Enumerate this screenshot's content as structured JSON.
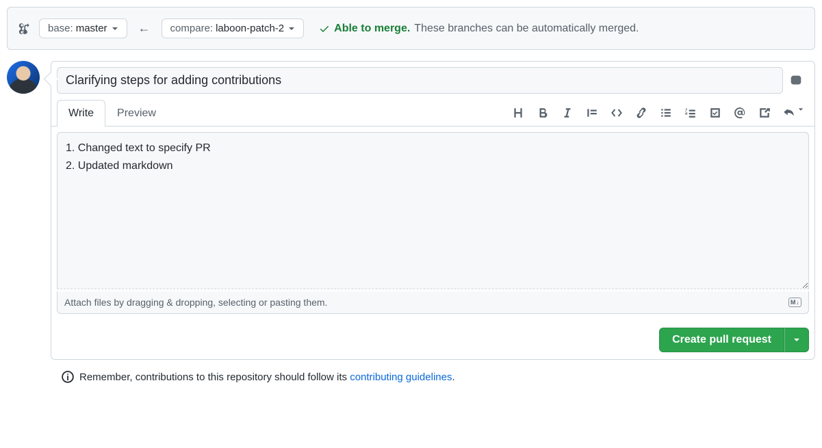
{
  "compare": {
    "base_label": "base: ",
    "base_branch": "master",
    "compare_label": "compare: ",
    "compare_branch": "laboon-patch-2",
    "merge_status_strong": "Able to merge.",
    "merge_status_rest": " These branches can be automatically merged."
  },
  "form": {
    "title_value": "Clarifying steps for adding contributions",
    "tabs": {
      "write": "Write",
      "preview": "Preview"
    },
    "body_value": "1. Changed text to specify PR\n2. Updated markdown",
    "attach_hint": "Attach files by dragging & dropping, selecting or pasting them.",
    "md_badge": "M↓",
    "submit_label": "Create pull request"
  },
  "footer": {
    "text_before": "Remember, contributions to this repository should follow its ",
    "link_text": "contributing guidelines",
    "text_after": "."
  }
}
